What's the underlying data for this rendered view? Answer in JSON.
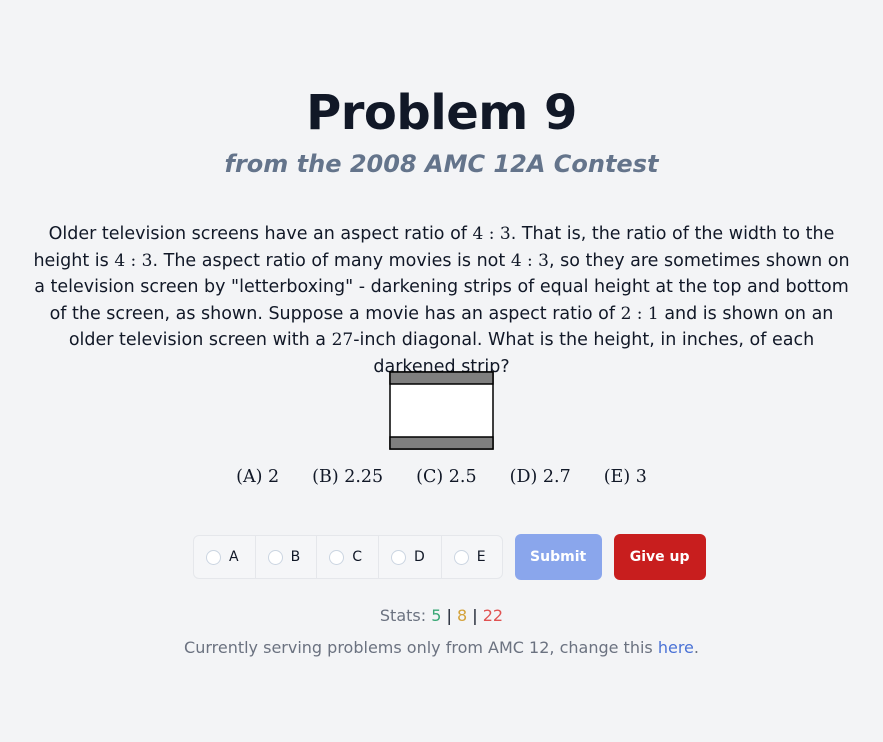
{
  "page": {
    "title": "Problem 9",
    "subtitle": "from the 2008 AMC 12A Contest"
  },
  "problem": {
    "t1": "Older television screens have an aspect ratio of ",
    "m1": "4 : 3",
    "t2": ". That is, the ratio of the width to the height is ",
    "m2": "4 : 3",
    "t3": ". The aspect ratio of many movies is not ",
    "m3": "4 : 3",
    "t4": ", so they are sometimes shown on a television screen by \"letterboxing\" - darkening strips of equal height at the top and bottom of the screen, as shown. Suppose a movie has an aspect ratio of ",
    "m4": "2 : 1",
    "t5": " and is shown on an older television screen with a ",
    "m5": "27",
    "t6": "-inch diagonal. What is the height, in inches, of each darkened strip?"
  },
  "choices": [
    "(A) 2",
    "(B) 2.25",
    "(C) 2.5",
    "(D) 2.7",
    "(E) 3"
  ],
  "answer_options": [
    "A",
    "B",
    "C",
    "D",
    "E"
  ],
  "buttons": {
    "submit": "Submit",
    "give_up": "Give up"
  },
  "stats": {
    "label": "Stats: ",
    "green": "5",
    "orange": "8",
    "red": "22",
    "separator": "|"
  },
  "footer": {
    "text": "Currently serving problems only from AMC 12, change this ",
    "link": "here",
    "end": "."
  },
  "colors": {
    "background": "#f3f4f6",
    "submit": "#8aa6ec",
    "give_up": "#c81e1e",
    "link": "#4a72d6"
  }
}
